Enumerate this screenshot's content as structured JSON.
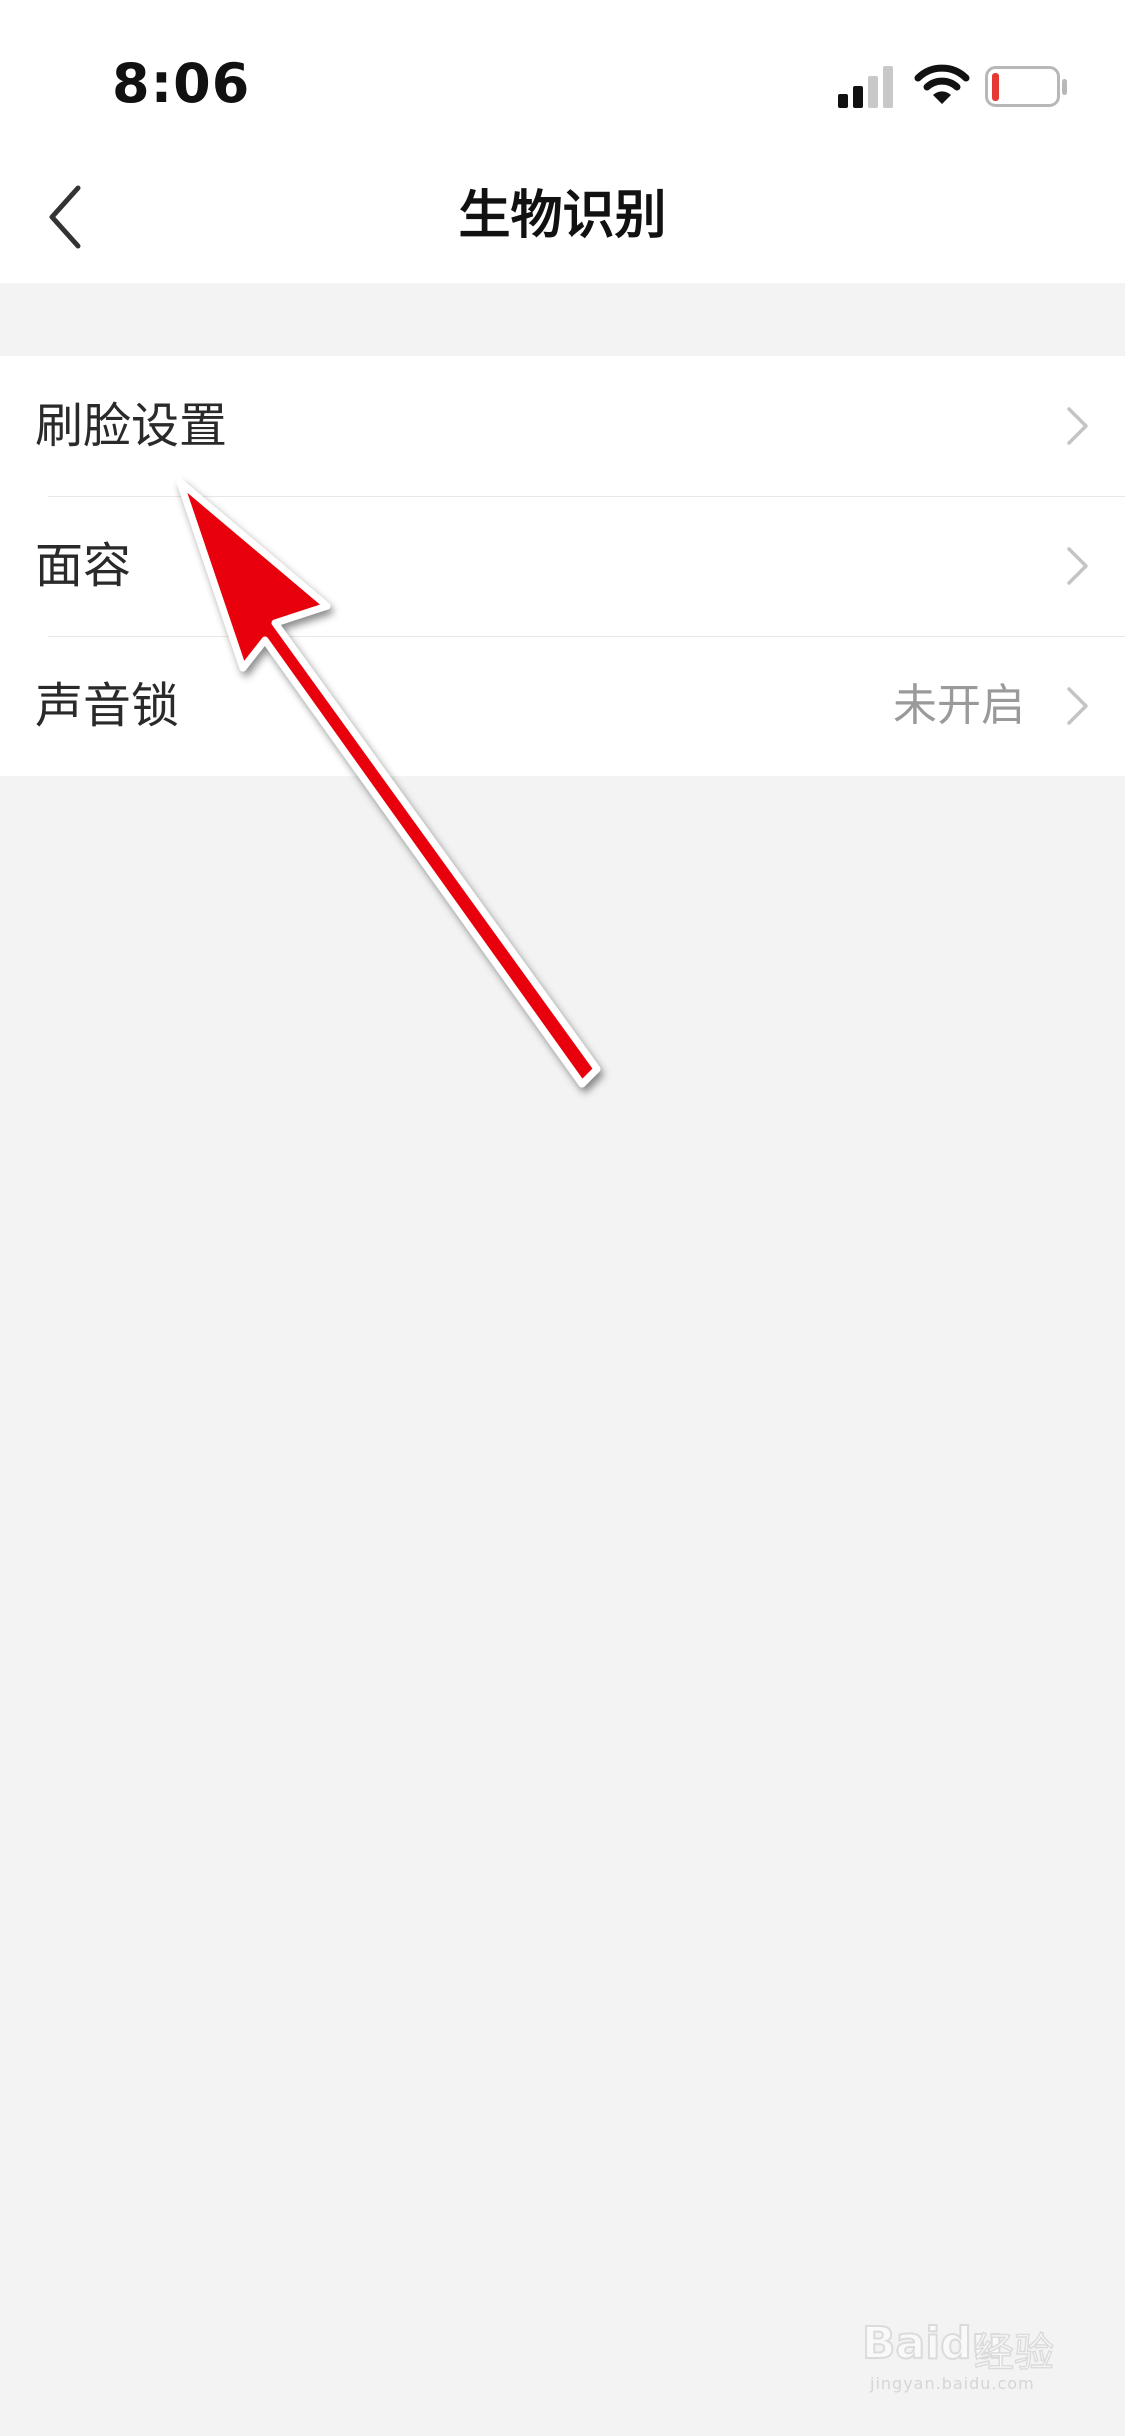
{
  "status_bar": {
    "time": "8:06",
    "icons": [
      "cellular-signal-icon",
      "wifi-icon",
      "battery-low-icon"
    ]
  },
  "nav": {
    "title": "生物识别",
    "back_icon": "chevron-left-icon"
  },
  "settings": {
    "items": [
      {
        "label": "刷脸设置",
        "value": ""
      },
      {
        "label": "面容",
        "value": ""
      },
      {
        "label": "声音锁",
        "value": "未开启"
      }
    ]
  },
  "annotation": {
    "arrow_color": "#e8000a",
    "points_to": "刷脸设置"
  },
  "watermark": {
    "logo": "Baidu",
    "brand": "经验",
    "url": "jingyan.baidu.com"
  },
  "colors": {
    "background": "#f3f3f3",
    "surface": "#ffffff",
    "battery_low": "#e53935"
  }
}
